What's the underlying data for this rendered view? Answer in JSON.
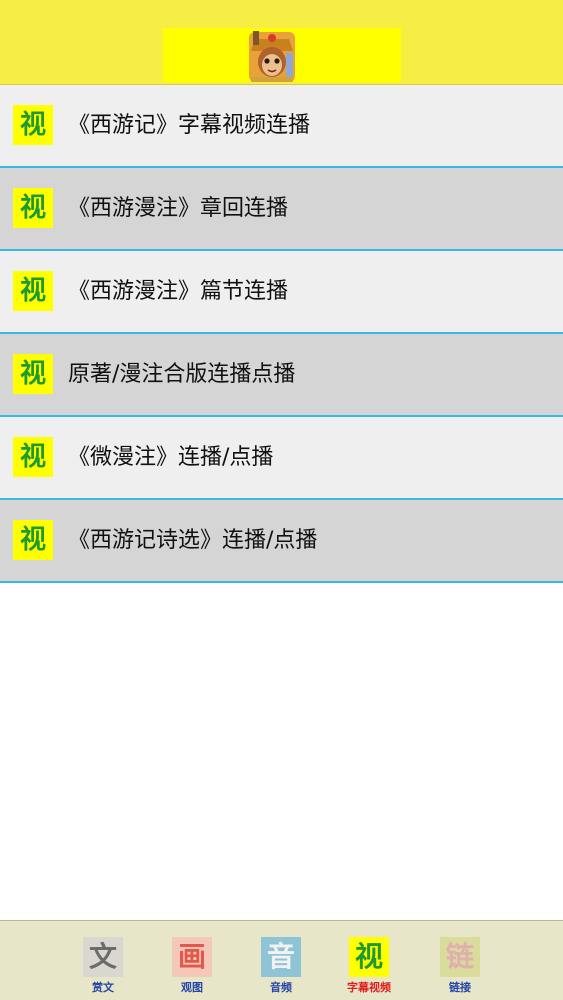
{
  "header": {
    "logo_icon": "monkey-king-avatar-icon"
  },
  "list": {
    "badge_char": "视",
    "items": [
      {
        "label": "《西游记》字幕视频连播"
      },
      {
        "label": "《西游漫注》章回连播"
      },
      {
        "label": "《西游漫注》篇节连播"
      },
      {
        "label": "原著/漫注合版连播点播"
      },
      {
        "label": "《微漫注》连播/点播"
      },
      {
        "label": "《西游记诗选》连播/点播"
      }
    ]
  },
  "tabbar": {
    "active_index": 3,
    "tabs": [
      {
        "icon_char": "文",
        "label": "赏文",
        "icon": "text-icon"
      },
      {
        "icon_char": "画",
        "label": "观图",
        "icon": "picture-icon"
      },
      {
        "icon_char": "音",
        "label": "音频",
        "icon": "audio-icon"
      },
      {
        "icon_char": "视",
        "label": "字幕视频",
        "icon": "video-icon"
      },
      {
        "icon_char": "链",
        "label": "链接",
        "icon": "link-icon"
      }
    ]
  },
  "colors": {
    "header_bg": "#f7ee45",
    "badge_bg": "#ffff00",
    "badge_text": "#1f9a2e",
    "row_divider": "#39b7e6",
    "tab_label": "#2546a8",
    "tab_label_active": "#e01e1e"
  }
}
